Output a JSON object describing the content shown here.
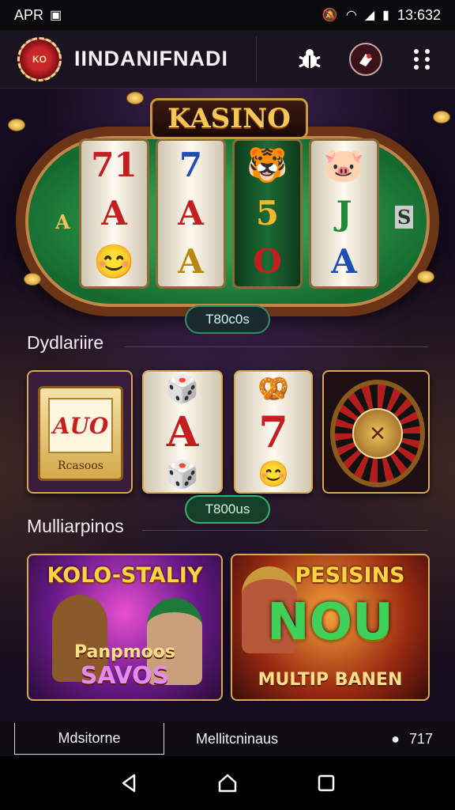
{
  "status_bar": {
    "carrier": "APR",
    "time": "13:632"
  },
  "app_bar": {
    "logo_text": "KO",
    "title": "IINDANIFNADI",
    "icons": [
      "bug-icon",
      "gamepad-icon",
      "more-icon"
    ]
  },
  "hero": {
    "title": "KASINO",
    "reels": [
      [
        "71",
        "A",
        "😊"
      ],
      [
        "7",
        "A",
        "A"
      ],
      [
        "🐯",
        "5",
        "O"
      ],
      [
        "🐷",
        "J",
        "A"
      ]
    ],
    "badge": "T80c0s"
  },
  "section_1": {
    "title": "Dydlariire",
    "tiles": [
      {
        "top": "AUO",
        "sub": "Rcasoos"
      },
      {
        "symbols": [
          "🎲",
          "A",
          "🎲"
        ]
      },
      {
        "symbols": [
          "🥨",
          "7",
          "😊"
        ]
      },
      {
        "kind": "roulette"
      }
    ],
    "badge": "T800us"
  },
  "section_2": {
    "title": "Mulliarpinos",
    "banners": [
      {
        "head": "KOLO-STALIY",
        "foot_left": "Panpmoos",
        "foot_right": "SAVOS"
      },
      {
        "head": "PESISINS",
        "middle": "NOU",
        "foot": "MULTIP BANEN"
      }
    ]
  },
  "tab_bar": {
    "tab_active": "Mdsitorne",
    "tab_second": "Mellitcninaus",
    "count": "717"
  },
  "colors": {
    "background": "#140b1e",
    "gold": "#d8a752",
    "green_accent": "#2fb36a"
  }
}
